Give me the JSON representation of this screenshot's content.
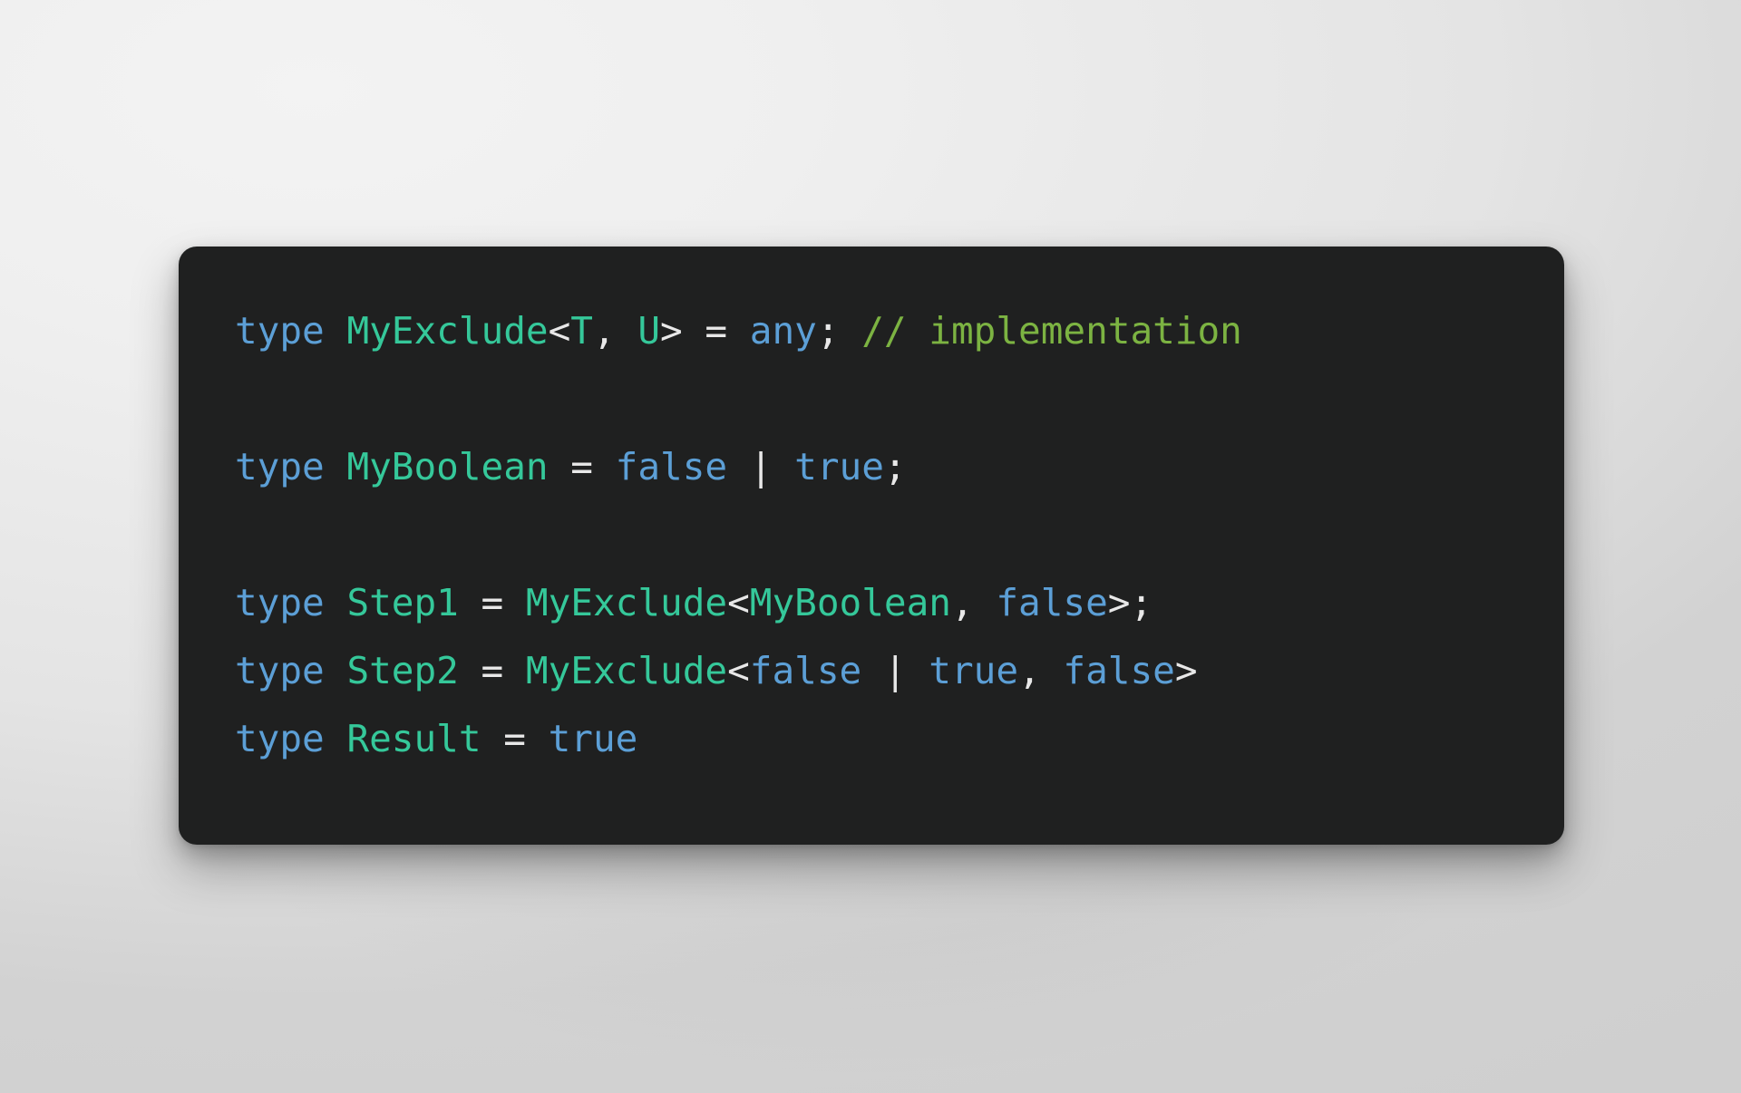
{
  "window": {
    "title": "TypeScript code snippet",
    "background_color": "#e9e9e9",
    "card_background": "#1f2020"
  },
  "theme": {
    "keyword_color": "#5c9fd6",
    "type_color": "#35c89a",
    "literal_color": "#5c9fd6",
    "punctuation_color": "#e8e8e8",
    "comment_color": "#7cb342"
  },
  "code": {
    "language": "typescript",
    "plain_text": "type MyExclude<T, U> = any; // implementation\n\ntype MyBoolean = false | true;\n\ntype Step1 = MyExclude<MyBoolean, false>;\ntype Step2 = MyExclude<false | true, false>\ntype Result = true",
    "lines": [
      {
        "index": 1,
        "text": "type MyExclude<T, U> = any; // implementation",
        "tokens": [
          {
            "t": "type",
            "k": "keyword"
          },
          {
            "t": " ",
            "k": "punct"
          },
          {
            "t": "MyExclude",
            "k": "type"
          },
          {
            "t": "<",
            "k": "punct"
          },
          {
            "t": "T",
            "k": "type"
          },
          {
            "t": ", ",
            "k": "punct"
          },
          {
            "t": "U",
            "k": "type"
          },
          {
            "t": "> = ",
            "k": "punct"
          },
          {
            "t": "any",
            "k": "literal"
          },
          {
            "t": "; ",
            "k": "punct"
          },
          {
            "t": "// implementation",
            "k": "comment"
          }
        ]
      },
      {
        "index": 2,
        "text": "",
        "tokens": []
      },
      {
        "index": 3,
        "text": "type MyBoolean = false | true;",
        "tokens": [
          {
            "t": "type",
            "k": "keyword"
          },
          {
            "t": " ",
            "k": "punct"
          },
          {
            "t": "MyBoolean",
            "k": "type"
          },
          {
            "t": " = ",
            "k": "punct"
          },
          {
            "t": "false",
            "k": "literal"
          },
          {
            "t": " | ",
            "k": "punct"
          },
          {
            "t": "true",
            "k": "literal"
          },
          {
            "t": ";",
            "k": "punct"
          }
        ]
      },
      {
        "index": 4,
        "text": "",
        "tokens": []
      },
      {
        "index": 5,
        "text": "type Step1 = MyExclude<MyBoolean, false>;",
        "tokens": [
          {
            "t": "type",
            "k": "keyword"
          },
          {
            "t": " ",
            "k": "punct"
          },
          {
            "t": "Step1",
            "k": "type"
          },
          {
            "t": " = ",
            "k": "punct"
          },
          {
            "t": "MyExclude",
            "k": "type"
          },
          {
            "t": "<",
            "k": "punct"
          },
          {
            "t": "MyBoolean",
            "k": "type"
          },
          {
            "t": ", ",
            "k": "punct"
          },
          {
            "t": "false",
            "k": "literal"
          },
          {
            "t": ">;",
            "k": "punct"
          }
        ]
      },
      {
        "index": 6,
        "text": "type Step2 = MyExclude<false | true, false>",
        "tokens": [
          {
            "t": "type",
            "k": "keyword"
          },
          {
            "t": " ",
            "k": "punct"
          },
          {
            "t": "Step2",
            "k": "type"
          },
          {
            "t": " = ",
            "k": "punct"
          },
          {
            "t": "MyExclude",
            "k": "type"
          },
          {
            "t": "<",
            "k": "punct"
          },
          {
            "t": "false",
            "k": "literal"
          },
          {
            "t": " | ",
            "k": "punct"
          },
          {
            "t": "true",
            "k": "literal"
          },
          {
            "t": ", ",
            "k": "punct"
          },
          {
            "t": "false",
            "k": "literal"
          },
          {
            "t": ">",
            "k": "punct"
          }
        ]
      },
      {
        "index": 7,
        "text": "type Result = true",
        "tokens": [
          {
            "t": "type",
            "k": "keyword"
          },
          {
            "t": " ",
            "k": "punct"
          },
          {
            "t": "Result",
            "k": "type"
          },
          {
            "t": " = ",
            "k": "punct"
          },
          {
            "t": "true",
            "k": "literal"
          }
        ]
      }
    ]
  }
}
